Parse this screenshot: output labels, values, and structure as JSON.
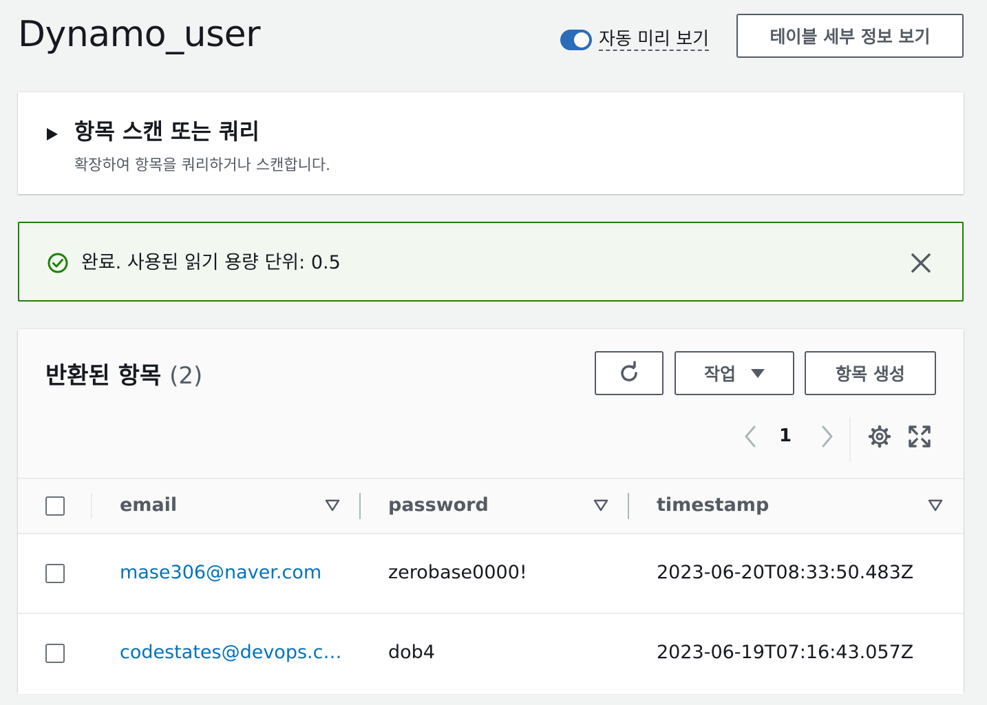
{
  "header": {
    "title": "Dynamo_user",
    "auto_preview_label": "자동 미리 보기",
    "auto_preview_on": true,
    "table_details_label": "테이블 세부 정보 보기"
  },
  "scan_panel": {
    "title": "항목 스캔 또는 쿼리",
    "description": "확장하여 항목을 쿼리하거나 스캔합니다."
  },
  "alert": {
    "message": "완료. 사용된 읽기 용량 단위: 0.5",
    "status_color": "#1d8102"
  },
  "items": {
    "title": "반환된 항목",
    "count": "(2)",
    "actions_label": "작업",
    "create_label": "항목 생성",
    "page": "1",
    "columns": [
      "email",
      "password",
      "timestamp"
    ],
    "rows": [
      {
        "email": "mase306@naver.com",
        "password": "zerobase0000!",
        "timestamp": "2023-06-20T08:33:50.483Z"
      },
      {
        "email": "codestates@devops.c…",
        "password": "dob4",
        "timestamp": "2023-06-19T07:16:43.057Z"
      }
    ]
  },
  "colors": {
    "accent": "#2a6cba",
    "link": "#0073bb"
  },
  "icons": [
    "play-icon",
    "check-circle-icon",
    "close-icon",
    "refresh-icon",
    "caret-down-icon",
    "chevron-left-icon",
    "chevron-right-icon",
    "gear-icon",
    "fullscreen-icon",
    "sort-icon"
  ]
}
